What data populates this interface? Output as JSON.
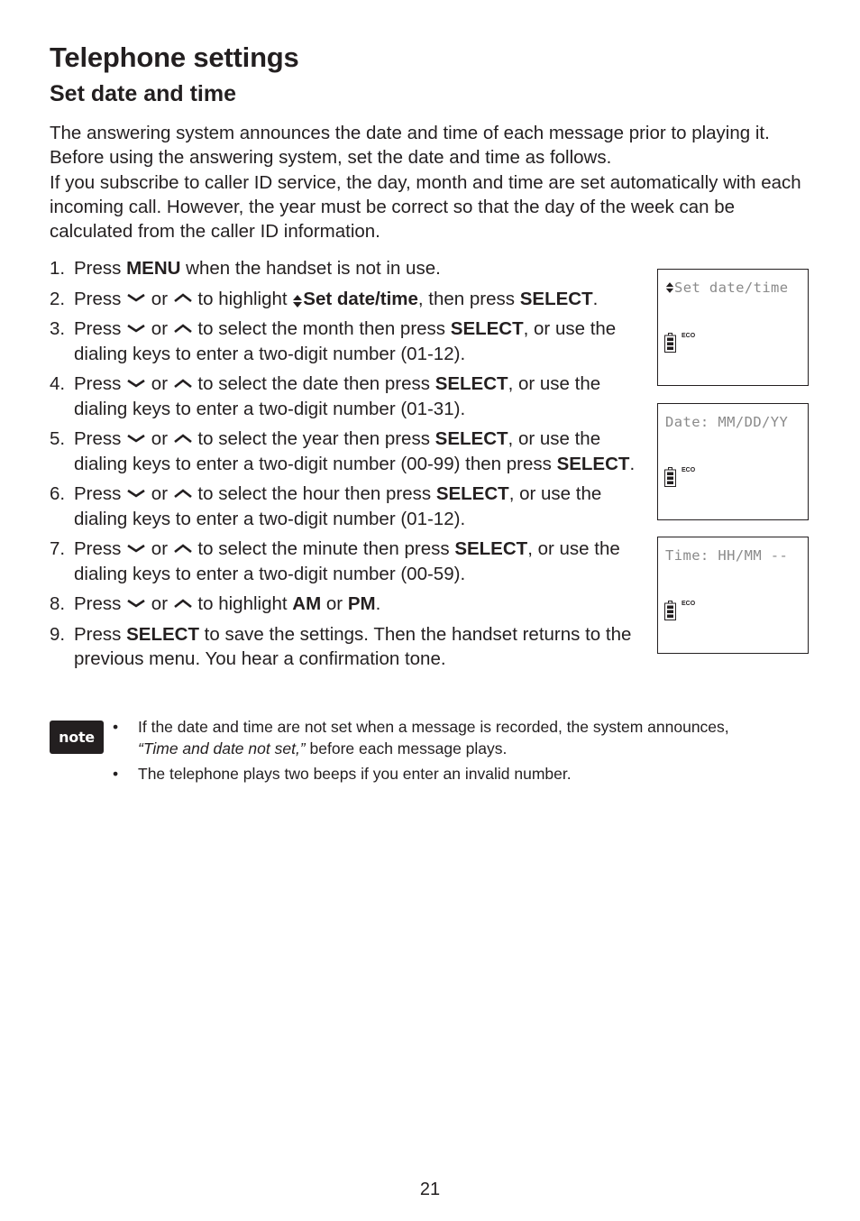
{
  "header": {
    "title": "Telephone settings",
    "section": "Set date and time"
  },
  "intro": {
    "paragraph1": "The answering system announces the date and time of each message prior to playing it. Before using the answering system, set the date and time as follows.",
    "paragraph2": "If you subscribe to caller ID service, the day, month and time are set automatically with each incoming call. However, the year must be correct so that the day of the week can be calculated from the caller ID information."
  },
  "icons": {
    "down_key": "down-arrow-key-icon",
    "up_key": "up-arrow-key-icon",
    "scroll": "up-down-scroll-icon",
    "battery": "battery-icon"
  },
  "steps": [
    {
      "num": "1.",
      "t1": "Press ",
      "b1": "MENU",
      "t2": " when the handset is not in use."
    },
    {
      "num": "2.",
      "t1": "Press ",
      "or": " or ",
      "t2": " to highlight ",
      "b1": "Set date/time",
      "t3": ", then press ",
      "b2": "SELECT",
      "t4": "."
    },
    {
      "num": "3.",
      "t1": "Press ",
      "or": " or ",
      "t2": " to select the month then press ",
      "b1": "SELECT",
      "t3": ", or use the dialing keys to enter a two-digit number (01-12)."
    },
    {
      "num": "4.",
      "t1": "Press ",
      "or": " or ",
      "t2": " to select the date then press ",
      "b1": "SELECT",
      "t3": ", or use the dialing keys to enter a two-digit number (01-31)."
    },
    {
      "num": "5.",
      "t1": "Press ",
      "or": " or ",
      "t2": " to select the year then press ",
      "b1": "SELECT",
      "t3": ", or use the dialing keys to enter a two-digit number (00-99) then press ",
      "b2": "SELECT",
      "t4": "."
    },
    {
      "num": "6.",
      "t1": "Press ",
      "or": " or ",
      "t2": " to select the hour then press ",
      "b1": "SELECT",
      "t3": ", or use the dialing keys to enter a two-digit number (01-12)."
    },
    {
      "num": "7.",
      "t1": "Press ",
      "or": " or ",
      "t2": " to select the minute then press ",
      "b1": "SELECT",
      "t3": ", or use the dialing keys to enter a two-digit number (00-59)."
    },
    {
      "num": "8.",
      "t1": "Press ",
      "or": " or ",
      "t2": " to highlight ",
      "b1": "AM",
      "t3": " or ",
      "b2": "PM",
      "t4": "."
    },
    {
      "num": "9.",
      "t1": "Press ",
      "b1": "SELECT",
      "t2": " to save the settings. Then the handset returns to the previous menu. You hear a confirmation tone."
    }
  ],
  "screens": [
    {
      "arrows": "♦",
      "text": "Set date/time",
      "eco": "ECO"
    },
    {
      "text": "Date: MM/DD/YY",
      "eco": "ECO"
    },
    {
      "text": "Time: HH/MM --",
      "eco": "ECO"
    }
  ],
  "note": {
    "badge": "note",
    "bullet": "•",
    "item1_pre": "If the date and time are not set when a message is recorded, the system announces, ",
    "item1_italic": "“Time and date not set,”",
    "item1_post": " before each message plays.",
    "item2": "The telephone plays two beeps if you enter an invalid number."
  },
  "footer": {
    "page_number": "21"
  }
}
